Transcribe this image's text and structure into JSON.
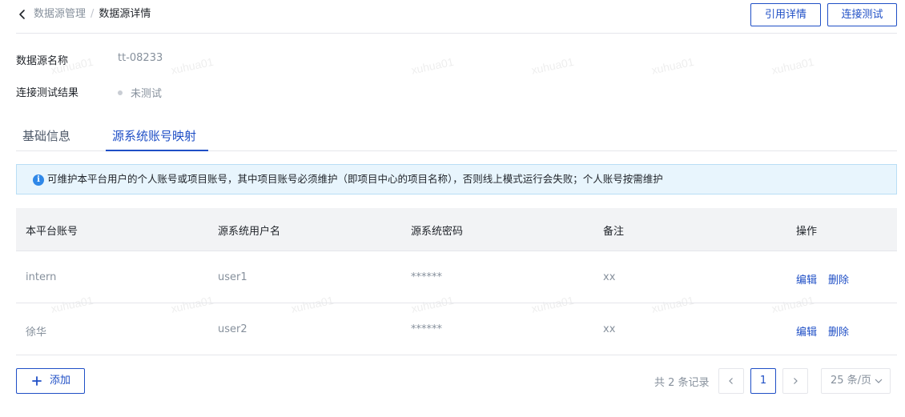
{
  "header": {
    "breadcrumb_parent": "数据源管理",
    "breadcrumb_separator": "/",
    "breadcrumb_current": "数据源详情",
    "btn_reference_detail": "引用详情",
    "btn_connection_test": "连接测试"
  },
  "info": {
    "name_label": "数据源名称",
    "name_value": "tt-08233",
    "test_result_label": "连接测试结果",
    "test_result_value": "未测试"
  },
  "tabs": [
    {
      "label": "基础信息",
      "active": false
    },
    {
      "label": "源系统账号映射",
      "active": true
    }
  ],
  "alert": {
    "icon": "info-icon",
    "text": "可维护本平台用户的个人账号或项目账号，其中项目账号必须维护（即项目中心的项目名称），否则线上模式运行会失败；个人账号按需维护"
  },
  "table": {
    "columns": [
      "本平台账号",
      "源系统用户名",
      "源系统密码",
      "备注",
      "操作"
    ],
    "rows": [
      {
        "account": "intern",
        "username": "user1",
        "password": "******",
        "remark": "xx"
      },
      {
        "account": "徐华",
        "username": "user2",
        "password": "******",
        "remark": "xx"
      }
    ],
    "action_edit": "编辑",
    "action_delete": "删除"
  },
  "footer": {
    "add_label": "添加",
    "total_text": "共 2 条记录",
    "current_page": "1",
    "page_size": "25 条/页"
  },
  "watermark": "xuhua01",
  "colors": {
    "primary": "#1f4fc6",
    "alert_bg": "#e8f5fd",
    "alert_border": "#b9def5",
    "header_bg": "#f2f3f5",
    "muted_text": "#86909c"
  }
}
